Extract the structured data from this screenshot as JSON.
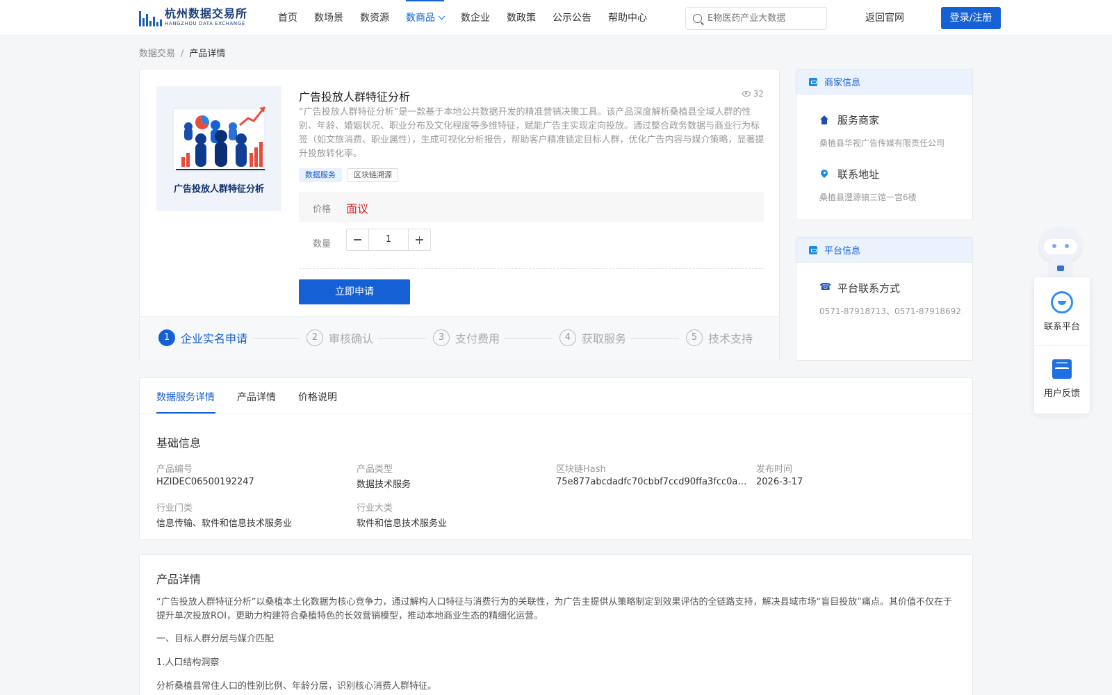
{
  "header": {
    "logo_cn": "杭州数据交易所",
    "logo_en": "HANGZHOU DATA EXCHANGE",
    "nav": [
      "首页",
      "数场景",
      "数资源",
      "数商品",
      "数企业",
      "数政策",
      "公示公告",
      "帮助中心"
    ],
    "active_nav": "数商品",
    "search_placeholder": "E物医药产业大数据",
    "back_link": "返回官网",
    "login": "登录/注册"
  },
  "breadcrumb": {
    "root": "数据交易",
    "separator": "/",
    "current": "产品详情"
  },
  "product": {
    "image_title": "广告投放人群特征分析",
    "title": "广告投放人群特征分析",
    "views": "32",
    "description": "“广告投放人群特征分析”是一款基于本地公共数据开发的精准营销决策工具。该产品深度解析桑植县全域人群的性别、年龄、婚姻状况、职业分布及文化程度等多维特征，赋能广告主实现定向投放。通过整合政务数据与商业行为标签（如文旅消费、职业属性），生成可视化分析报告，帮助客户精准锁定目标人群，优化广告内容与媒介策略，显著提升投放转化率。",
    "tags": [
      "数据服务",
      "区块链溯源"
    ],
    "price_label": "价格",
    "price_value": "面议",
    "qty_label": "数量",
    "qty_value": "1",
    "apply_button": "立即申请",
    "steps": [
      {
        "num": "1",
        "label": "企业实名申请"
      },
      {
        "num": "2",
        "label": "审核确认"
      },
      {
        "num": "3",
        "label": "支付费用"
      },
      {
        "num": "4",
        "label": "获取服务"
      },
      {
        "num": "5",
        "label": "技术支持"
      }
    ]
  },
  "merchant": {
    "header": "商家信息",
    "service_label": "服务商家",
    "service_value": "桑植县华视广告传媒有限责任公司",
    "address_label": "联系地址",
    "address_value": "桑植县澧源镇三馆一宫6楼"
  },
  "platform": {
    "header": "平台信息",
    "contact_label": "平台联系方式",
    "contact_value": "0571-87918713、0571-87918692"
  },
  "float": {
    "contact": "联系平台",
    "feedback": "用户反馈"
  },
  "tabs": [
    "数据服务详情",
    "产品详情",
    "价格说明"
  ],
  "basic_info": {
    "title": "基础信息",
    "fields": [
      {
        "label": "产品编号",
        "value": "HZIDEC06500192247"
      },
      {
        "label": "产品类型",
        "value": "数据技术服务"
      },
      {
        "label": "区块链Hash",
        "value": "75e877abcdadfc70cbbf7ccd90ffa3fcc0a70…"
      },
      {
        "label": "发布时间",
        "value": "2026-3-17"
      },
      {
        "label": "行业门类",
        "value": "信息传输、软件和信息技术服务业"
      },
      {
        "label": "行业大类",
        "value": "软件和信息技术服务业"
      }
    ]
  },
  "detail": {
    "title": "产品详情",
    "paragraph": "“广告投放人群特征分析”以桑植本土化数据为核心竞争力，通过解构人口特征与消费行为的关联性，为广告主提供从策略制定到效果评估的全链路支持，解决县域市场“盲目投放”痛点。其价值不仅在于提升单次投放ROI，更助力构建符合桑植特色的长效营销模型，推动本地商业生态的精细化运营。",
    "h1": "一、目标人群分层与媒介匹配",
    "h2": "1.人口结构洞察",
    "line": "分析桑植县常住人口的性别比例、年龄分层，识别核心消费人群特征。"
  },
  "colors": {
    "primary": "#1660d6",
    "price": "#e02020"
  }
}
